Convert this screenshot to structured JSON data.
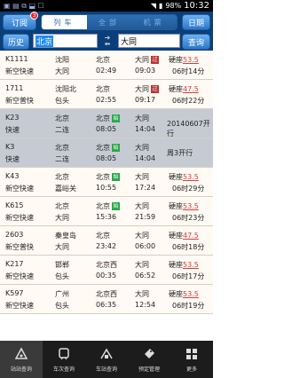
{
  "statusbar": {
    "battery": "98%",
    "time": "10:32"
  },
  "header": {
    "subscribe_label": "订阅",
    "subscribe_badge": "3",
    "tabs": [
      "列车",
      "全部",
      "机票"
    ],
    "date_label": "日期",
    "history_label": "历史",
    "from_value": "北京",
    "to_value": "大同",
    "search_label": "查询"
  },
  "trains": [
    {
      "no": "K1111",
      "type": "新空快速",
      "from": "沈阳",
      "from2": "大同",
      "depart_city": "北京",
      "dep": "02:49",
      "dest": "大同",
      "arr": "09:03",
      "seat": "硬座",
      "price": "53.5",
      "dur": "06时14分",
      "pass_mark": "过",
      "start_mark": "",
      "note": "",
      "gray": false
    },
    {
      "no": "1711",
      "type": "新空普快",
      "from": "沈阳北",
      "from2": "包头",
      "depart_city": "北京",
      "dep": "02:55",
      "dest": "大同",
      "arr": "09:17",
      "seat": "硬座",
      "price": "47.5",
      "dur": "06时22分",
      "pass_mark": "过",
      "start_mark": "",
      "note": "",
      "gray": false
    },
    {
      "no": "K23",
      "type": "快速",
      "from": "北京",
      "from2": "二连",
      "depart_city": "北京",
      "dep": "08:05",
      "dest": "大同",
      "arr": "14:04",
      "seat": "",
      "price": "",
      "dur": "",
      "pass_mark": "",
      "start_mark": "始",
      "note": "20140607开行",
      "gray": true
    },
    {
      "no": "K3",
      "type": "快速",
      "from": "北京",
      "from2": "二连",
      "depart_city": "北京",
      "dep": "08:05",
      "dest": "大同",
      "arr": "14:04",
      "seat": "",
      "price": "",
      "dur": "",
      "pass_mark": "",
      "start_mark": "始",
      "note": "周3开行",
      "gray": true
    },
    {
      "no": "K43",
      "type": "新空快速",
      "from": "北京",
      "from2": "嘉峪关",
      "depart_city": "北京",
      "dep": "10:55",
      "dest": "大同",
      "arr": "17:24",
      "seat": "硬座",
      "price": "53.5",
      "dur": "06时29分",
      "pass_mark": "",
      "start_mark": "始",
      "note": "",
      "gray": false
    },
    {
      "no": "K615",
      "type": "新空快速",
      "from": "北京",
      "from2": "大同",
      "depart_city": "北京",
      "dep": "15:36",
      "dest": "大同",
      "arr": "21:59",
      "seat": "硬座",
      "price": "53.5",
      "dur": "06时23分",
      "pass_mark": "",
      "start_mark": "始",
      "note": "",
      "gray": false
    },
    {
      "no": "2603",
      "type": "新空普快",
      "from": "秦皇岛",
      "from2": "大同",
      "depart_city": "北京",
      "dep": "23:42",
      "dest": "大同",
      "arr": "06:00",
      "seat": "硬座",
      "price": "47.5",
      "dur": "06时18分",
      "pass_mark": "",
      "start_mark": "",
      "note": "",
      "gray": false
    },
    {
      "no": "K217",
      "type": "新空快速",
      "from": "邯郸",
      "from2": "包头",
      "depart_city": "北京西",
      "dep": "00:35",
      "dest": "大同",
      "arr": "06:52",
      "seat": "硬座",
      "price": "53.5",
      "dur": "06时17分",
      "pass_mark": "",
      "start_mark": "",
      "note": "",
      "gray": false
    },
    {
      "no": "K597",
      "type": "新空快速",
      "from": "广州",
      "from2": "包头",
      "depart_city": "北京西",
      "dep": "06:35",
      "dest": "大同",
      "arr": "12:54",
      "seat": "硬座",
      "price": "53.5",
      "dur": "06时19分",
      "pass_mark": "",
      "start_mark": "",
      "note": "",
      "gray": false
    }
  ],
  "tabbar": [
    {
      "label": "站站查询",
      "icon": "station-route-icon"
    },
    {
      "label": "车次查询",
      "icon": "train-number-icon"
    },
    {
      "label": "车站查询",
      "icon": "station-search-icon"
    },
    {
      "label": "预定管理",
      "icon": "booking-icon"
    },
    {
      "label": "更多",
      "icon": "more-icon"
    }
  ]
}
